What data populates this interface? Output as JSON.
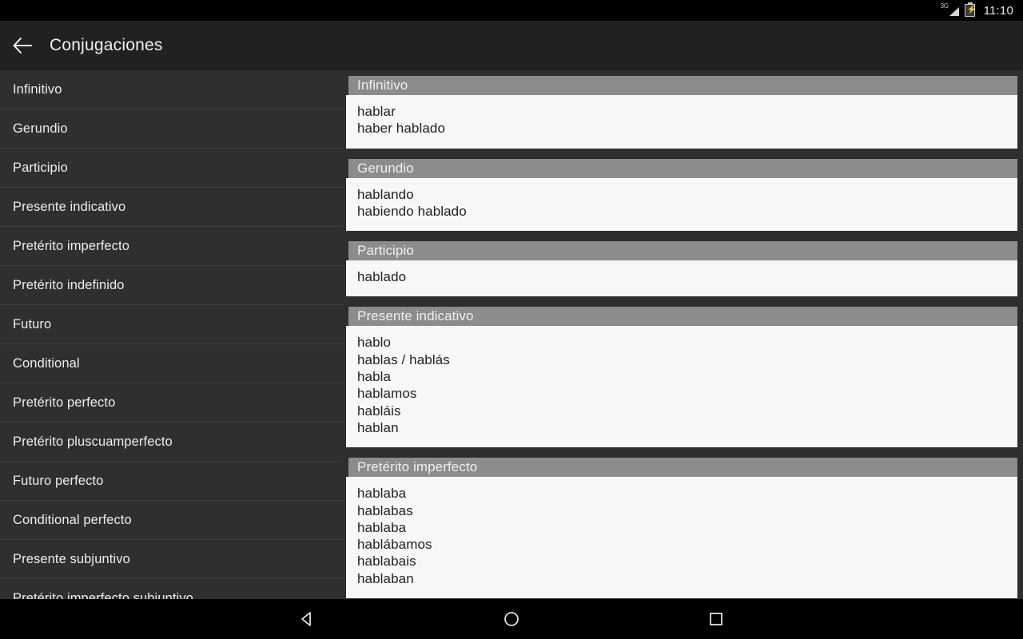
{
  "statusbar": {
    "network_label": "3G",
    "time": "11:10",
    "signal_icon": "signal-3g-icon",
    "battery_icon": "battery-charging-icon"
  },
  "toolbar": {
    "back_icon": "back-arrow-icon",
    "title": "Conjugaciones"
  },
  "sidebar": {
    "items": [
      {
        "label": "Infinitivo"
      },
      {
        "label": "Gerundio"
      },
      {
        "label": "Participio"
      },
      {
        "label": "Presente indicativo"
      },
      {
        "label": "Pretérito imperfecto"
      },
      {
        "label": "Pretérito indefinido"
      },
      {
        "label": "Futuro"
      },
      {
        "label": "Conditional"
      },
      {
        "label": "Pretérito perfecto"
      },
      {
        "label": "Pretérito pluscuamperfecto"
      },
      {
        "label": "Futuro perfecto"
      },
      {
        "label": "Conditional perfecto"
      },
      {
        "label": "Presente subjuntivo"
      },
      {
        "label": "Pretérito imperfecto subjuntivo"
      }
    ]
  },
  "panel": {
    "sections": [
      {
        "title": "Infinitivo",
        "lines": [
          "hablar",
          "haber hablado"
        ]
      },
      {
        "title": "Gerundio",
        "lines": [
          "hablando",
          "habiendo hablado"
        ]
      },
      {
        "title": "Participio",
        "lines": [
          "hablado"
        ]
      },
      {
        "title": "Presente indicativo",
        "lines": [
          "hablo",
          "hablas / hablás",
          "habla",
          "hablamos",
          "habláis",
          "hablan"
        ]
      },
      {
        "title": "Pretérito imperfecto",
        "lines": [
          "hablaba",
          "hablabas",
          "hablaba",
          "hablábamos",
          "hablabais",
          "hablaban"
        ]
      }
    ]
  },
  "navbar": {
    "back_icon": "nav-back-triangle-icon",
    "home_icon": "nav-home-circle-icon",
    "recents_icon": "nav-recents-square-icon"
  },
  "colors": {
    "toolbar_bg": "#212121",
    "sidebar_bg": "#2f2f2f",
    "panel_bg": "#2e2e2e",
    "card_bg": "#f7f7f7",
    "card_header_bg": "#8c8c8c",
    "text_light": "#ededed",
    "text_dark": "#222222"
  }
}
